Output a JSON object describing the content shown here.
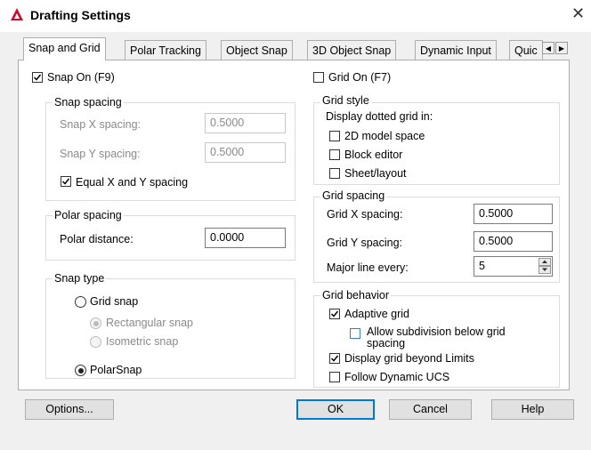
{
  "window": {
    "title": "Drafting Settings"
  },
  "tabs": [
    {
      "label": "Snap and Grid",
      "active": true
    },
    {
      "label": "Polar Tracking"
    },
    {
      "label": "Object Snap"
    },
    {
      "label": "3D Object Snap"
    },
    {
      "label": "Dynamic Input"
    },
    {
      "label": "Quic"
    }
  ],
  "snap": {
    "on_label": "Snap On (F9)",
    "on_checked": true,
    "spacing": {
      "legend": "Snap spacing",
      "x_label": "Snap X spacing:",
      "x_value": "0.5000",
      "y_label": "Snap Y spacing:",
      "y_value": "0.5000",
      "equal_label": "Equal X and Y spacing",
      "equal_checked": true
    },
    "polar": {
      "legend": "Polar spacing",
      "distance_label": "Polar distance:",
      "distance_value": "0.0000"
    },
    "type": {
      "legend": "Snap type",
      "grid_snap": "Grid snap",
      "rectangular": "Rectangular snap",
      "isometric": "Isometric snap",
      "polarsnap": "PolarSnap",
      "selected": "PolarSnap"
    }
  },
  "grid": {
    "on_label": "Grid On (F7)",
    "on_checked": false,
    "style": {
      "legend": "Grid style",
      "display_label": "Display dotted grid in:",
      "model_space": "2D model space",
      "block_editor": "Block editor",
      "sheet_layout": "Sheet/layout"
    },
    "spacing": {
      "legend": "Grid spacing",
      "x_label": "Grid X spacing:",
      "x_value": "0.5000",
      "y_label": "Grid Y spacing:",
      "y_value": "0.5000",
      "major_label": "Major line every:",
      "major_value": "5"
    },
    "behavior": {
      "legend": "Grid behavior",
      "adaptive": "Adaptive grid",
      "adaptive_checked": true,
      "subdivision_line1": "Allow subdivision below grid",
      "subdivision_line2": "spacing",
      "subdivision_checked": false,
      "beyond_limits": "Display grid beyond Limits",
      "beyond_checked": true,
      "follow_ucs": "Follow Dynamic UCS",
      "follow_checked": false
    }
  },
  "buttons": {
    "options": "Options...",
    "ok": "OK",
    "cancel": "Cancel",
    "help": "Help"
  },
  "colors": {
    "logo": "#c8102e",
    "focus_border": "#0078d7"
  }
}
